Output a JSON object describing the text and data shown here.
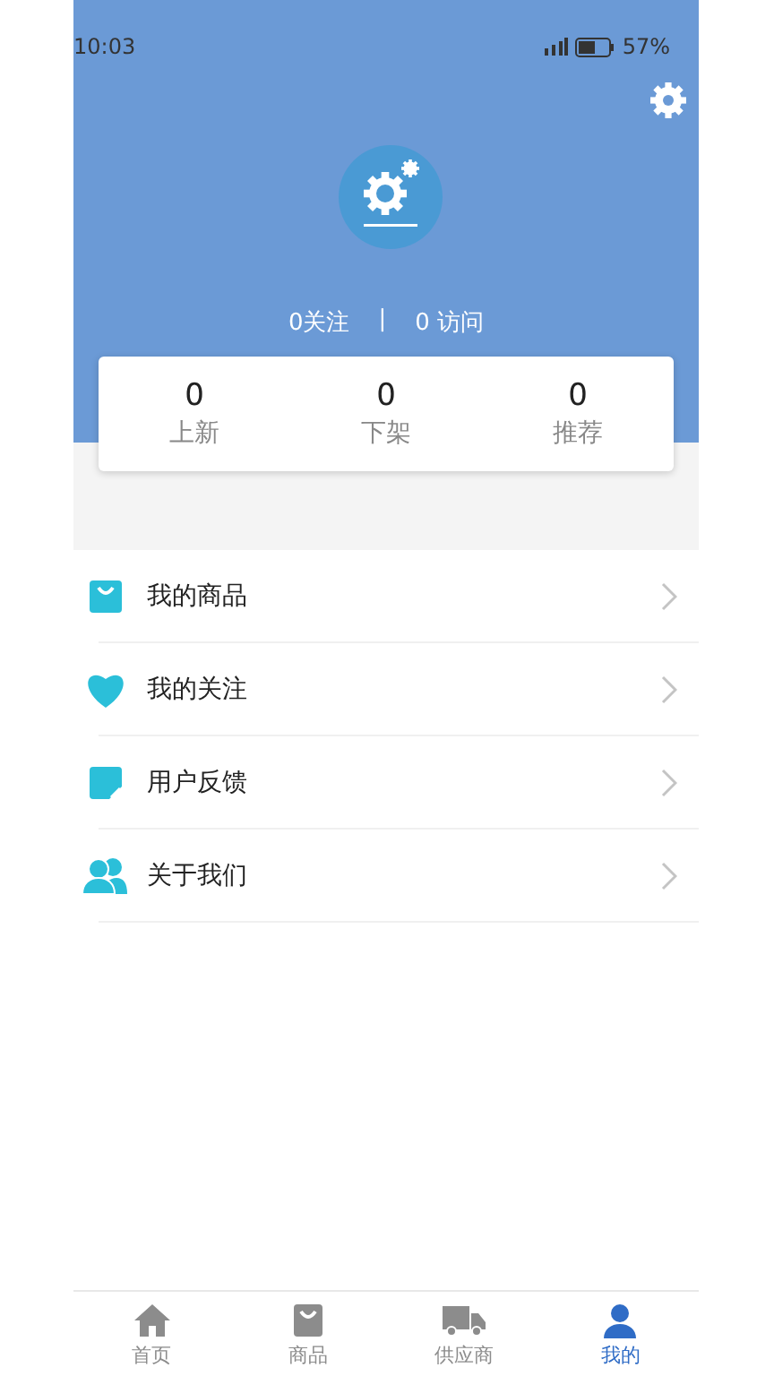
{
  "status_bar": {
    "time": "10:03",
    "battery": "57%"
  },
  "profile": {
    "follows": "0关注",
    "separator": "|",
    "visits": "0 访问"
  },
  "counters": [
    {
      "value": "0",
      "label": "上新"
    },
    {
      "value": "0",
      "label": "下架"
    },
    {
      "value": "0",
      "label": "推荐"
    }
  ],
  "menu": [
    {
      "kind": "bag",
      "label": "我的商品"
    },
    {
      "kind": "heart",
      "label": "我的关注"
    },
    {
      "kind": "note",
      "label": "用户反馈"
    },
    {
      "kind": "people",
      "label": "关于我们"
    }
  ],
  "tabs": [
    {
      "kind": "home",
      "label": "首页",
      "selected": false
    },
    {
      "kind": "bag",
      "label": "商品",
      "selected": false
    },
    {
      "kind": "truck",
      "label": "供应商",
      "selected": false
    },
    {
      "kind": "person",
      "label": "我的",
      "selected": true
    }
  ]
}
